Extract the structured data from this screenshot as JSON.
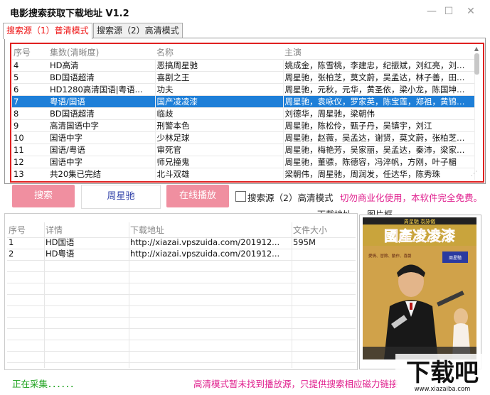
{
  "window": {
    "title": "电影搜索获取下载地址 V1.2",
    "minimize_glyph": "—",
    "maximize_glyph": "☐",
    "close_glyph": "✕"
  },
  "tabs": [
    {
      "label": "搜索源（1）普清模式",
      "active": true
    },
    {
      "label": "搜索源（2）高清模式",
      "active": false
    }
  ],
  "results": {
    "columns": [
      "序号",
      "集数(清晰度)",
      "名称",
      "主演"
    ],
    "rows": [
      {
        "no": "4",
        "quality": "HD高清",
        "name": "恶搞周星驰",
        "cast": "姚成金，陈雪桃，李建忠，纪振斌，刘红亮，刘智远"
      },
      {
        "no": "5",
        "quality": "BD国语超清",
        "name": "喜剧之王",
        "cast": "周星驰，张柏芝，莫文蔚，吴孟达，林子善，田启文，..."
      },
      {
        "no": "6",
        "quality": "HD1280高清国语|粤语...",
        "name": "功夫",
        "cast": "周星驰，元秋，元华，黄圣依，梁小龙，陈国坤，田..."
      },
      {
        "no": "7",
        "quality": "粤语/国语",
        "name": "国产凌凌漆",
        "cast": "周星驰，袁咏仪，罗家英，陈宝莲，郑祖，黄锦江，..."
      },
      {
        "no": "8",
        "quality": "BD国语超清",
        "name": "临歧",
        "cast": "刘德华，周星驰，梁朝伟"
      },
      {
        "no": "9",
        "quality": "高清国语中字",
        "name": "刑警本色",
        "cast": "周星驰，陈松伶，甄子丹，吴镇宇，刘江"
      },
      {
        "no": "10",
        "quality": "国语中字",
        "name": "少林足球",
        "cast": "周星驰，赵薇，吴孟达，谢贤，莫文蔚，张柏芝，黄..."
      },
      {
        "no": "11",
        "quality": "国语/粤语",
        "name": "审死官",
        "cast": "周星驰，梅艳芳，吴家丽，吴孟达，秦沛，梁家仁，..."
      },
      {
        "no": "12",
        "quality": "国语中字",
        "name": "师兄撞鬼",
        "cast": "周星驰，董骠，陈德容，冯淬帆，方刚，叶子楣"
      },
      {
        "no": "13",
        "quality": "共20集已完结",
        "name": "北斗双雄",
        "cast": "梁朝伟，周星驰，周润发，任达华，陈秀珠"
      }
    ],
    "selected_no": "7"
  },
  "controls": {
    "search_button": "搜索",
    "search_value": "周星驰",
    "play_button": "在线播放",
    "hd_checkbox_label": "搜索源（2）高清模式",
    "hd_checked": false,
    "notice": "切勿商业化使用，本软件完全免费。"
  },
  "downloads": {
    "section_label": "下载地址",
    "columns": [
      "序号",
      "详情",
      "下载地址",
      "文件大小"
    ],
    "rows": [
      {
        "no": "1",
        "detail": "HD国语",
        "url": "http://xiazai.vpszuida.com/201912...",
        "size": "595M"
      },
      {
        "no": "2",
        "detail": "HD粤语",
        "url": "http://xiazai.vpszuida.com/201912...",
        "size": ""
      }
    ]
  },
  "poster": {
    "section_label": "图片框",
    "title_text": "國產凌凌漆",
    "top_text": "周星馳 袁詠儀",
    "side_text": "愛情、冒險、動作、喜劇",
    "star_name": "周星馳"
  },
  "statusbar": {
    "status": "正在采集．．．．．．",
    "hint": "高清模式暂未找到播放源，只提供搜索相应磁力链接"
  },
  "watermark": {
    "brand": "下载吧",
    "url": "www.xiazaiba.com"
  },
  "colors": {
    "accent_red": "#e02020",
    "selection_blue": "#1e7fd8",
    "button_pink": "#f08fa0",
    "notice_magenta": "#e0208e",
    "status_green": "#18a018"
  }
}
